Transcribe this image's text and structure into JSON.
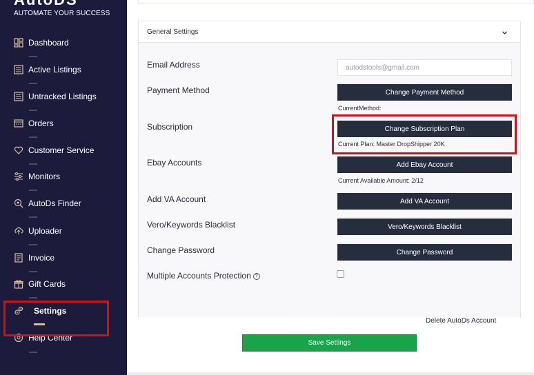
{
  "sidebar": {
    "logo": "AutoDS",
    "tagline": "AUTOMATE YOUR SUCCESS",
    "items": [
      {
        "label": "Dashboard",
        "icon": "dashboard-icon"
      },
      {
        "label": "Active Listings",
        "icon": "list-icon"
      },
      {
        "label": "Untracked Listings",
        "icon": "list-icon"
      },
      {
        "label": "Orders",
        "icon": "orders-icon"
      },
      {
        "label": "Customer Service",
        "icon": "heart-icon"
      },
      {
        "label": "Monitors",
        "icon": "sliders-icon"
      },
      {
        "label": "AutoDs Finder",
        "icon": "finder-icon"
      },
      {
        "label": "Uploader",
        "icon": "upload-icon"
      },
      {
        "label": "Invoice",
        "icon": "invoice-icon"
      },
      {
        "label": "Gift Cards",
        "icon": "gift-icon"
      },
      {
        "label": "Settings",
        "icon": "gear-icon",
        "active": true
      },
      {
        "label": "Help Center",
        "icon": "help-icon"
      }
    ]
  },
  "settings": {
    "card_title": "General Settings",
    "email": {
      "label": "Email Address",
      "value": "autodstools@gmail.com"
    },
    "payment": {
      "label": "Payment Method",
      "button": "Change Payment Method",
      "sub": "CurrentMethod:"
    },
    "subscription": {
      "label": "Subscription",
      "button": "Change Subscription Plan",
      "sub": "Current Plan: Master DropShipper 20K"
    },
    "ebay": {
      "label": "Ebay Accounts",
      "button": "Add Ebay Account",
      "sub": "Current Available Amount: 2/12"
    },
    "va": {
      "label": "Add VA Account",
      "button": "Add VA Account"
    },
    "vero": {
      "label": "Vero/Keywords Blacklist",
      "button": "Vero/Keywords Blacklist"
    },
    "password": {
      "label": "Change Password",
      "button": "Change Password"
    },
    "protection": {
      "label": "Multiple Accounts Protection",
      "help": "?",
      "checked": false
    },
    "delete_link": "Delete AutoDs Account",
    "save_button": "Save Settings"
  },
  "colors": {
    "sidebar_bg": "#1c1b3c",
    "button_bg": "#262e3d",
    "save_bg": "#1aa34a",
    "highlight": "#d60f16",
    "active_accent": "#e8b88a"
  }
}
